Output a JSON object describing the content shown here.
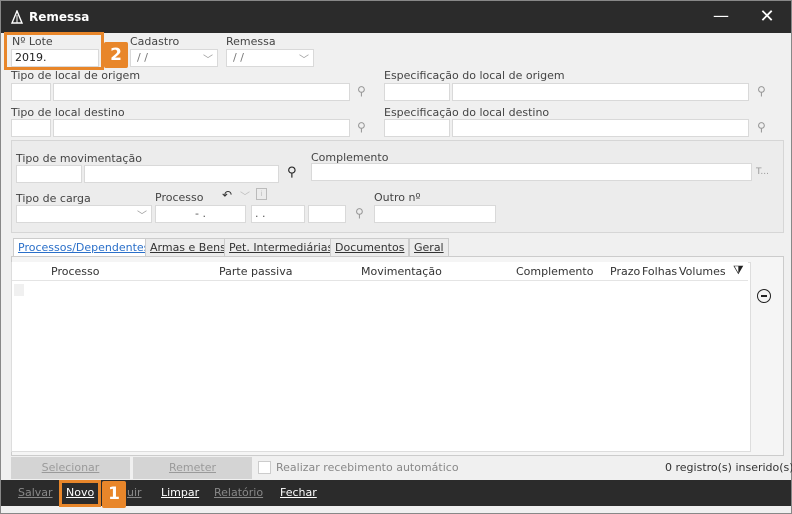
{
  "window": {
    "title": "Remessa",
    "minimize": "—",
    "close": "✕"
  },
  "header": {
    "lote_label": "Nº Lote",
    "lote_value": "2019.",
    "cadastro_label": "Cadastro",
    "cadastro_value": "/ /",
    "remessa_label": "Remessa",
    "remessa_value": "/ /"
  },
  "origem": {
    "tipo_label": "Tipo de local de origem",
    "espec_label": "Especificação do local de origem"
  },
  "destino": {
    "tipo_label": "Tipo de local destino",
    "espec_label": "Especificação do local destino"
  },
  "mov": {
    "tipo_label": "Tipo de movimentação",
    "complemento_label": "Complemento",
    "ellipsis": "T...",
    "carga_label": "Tipo de carga",
    "processo_label": "Processo",
    "processo_v1": "- .",
    "processo_v2": ". .",
    "outro_label": "Outro nº"
  },
  "tabs": [
    "Processos/Dependentes",
    "Armas e Bens",
    "Pet. Intermediárias",
    "Documentos",
    "Geral"
  ],
  "grid": {
    "columns": [
      "Processo",
      "Parte passiva",
      "Movimentação",
      "Complemento",
      "Prazo",
      "Folhas",
      "Volumes"
    ]
  },
  "footer": {
    "selecionar": "Selecionar",
    "remeter": "Remeter",
    "auto_label": "Realizar recebimento automático",
    "count": "0 registro(s) inserido(s)"
  },
  "toolbar": {
    "salvar": "Salvar",
    "novo": "Novo",
    "excluir": "uir",
    "limpar": "Limpar",
    "relatorio": "Relatório",
    "fechar": "Fechar"
  },
  "callouts": {
    "one": "1",
    "two": "2"
  }
}
